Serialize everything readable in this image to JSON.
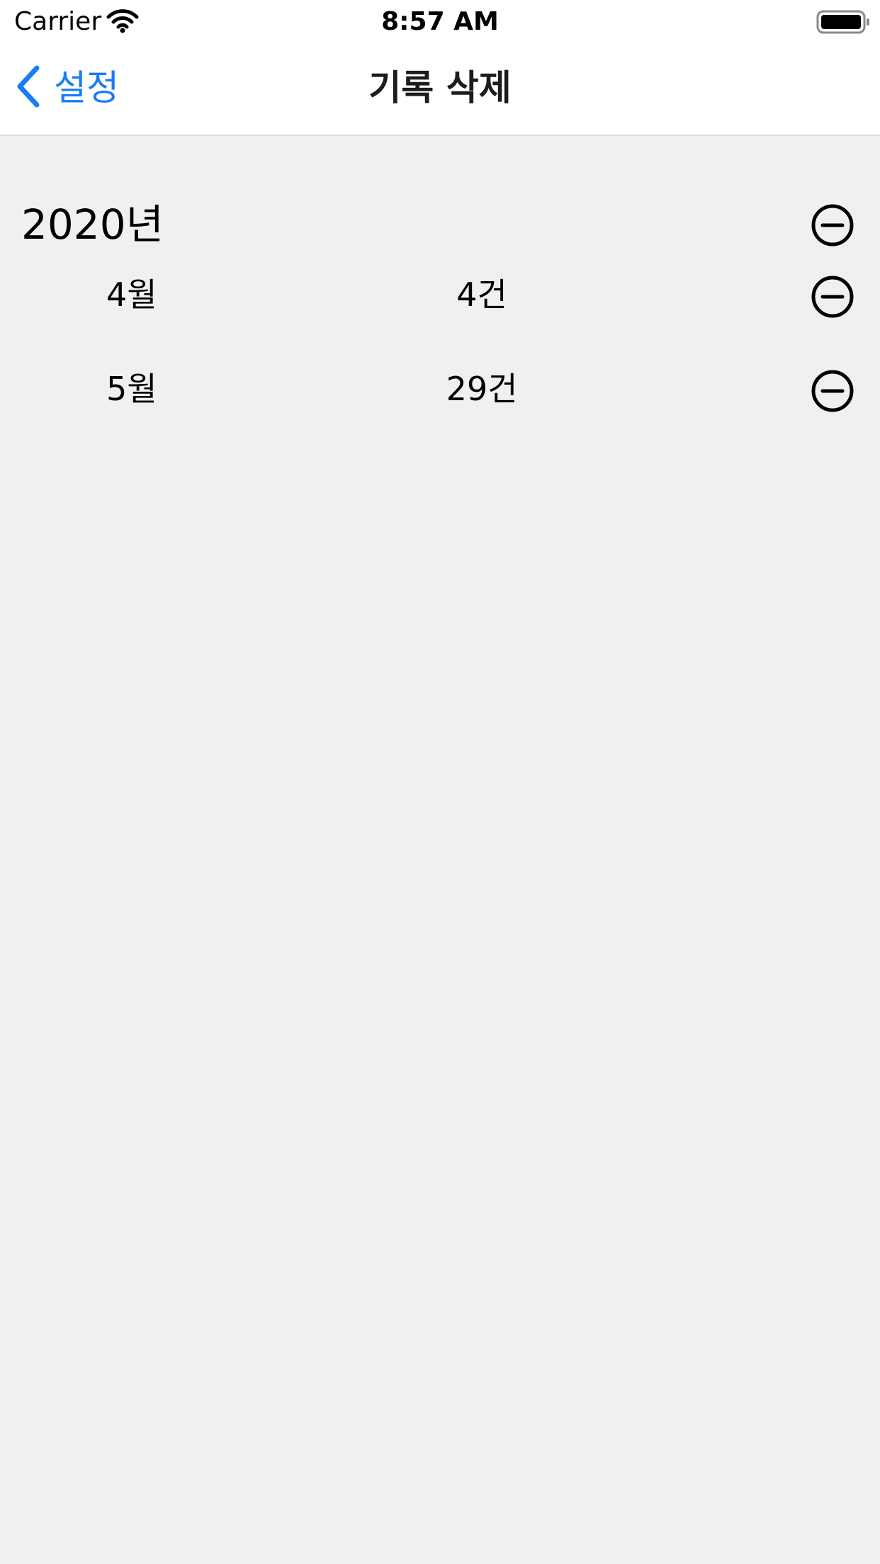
{
  "status_bar": {
    "carrier": "Carrier",
    "time": "8:57 AM"
  },
  "nav": {
    "back_label": "설정",
    "title": "기록 삭제"
  },
  "year_section": {
    "year_label": "2020년",
    "months": [
      {
        "month": "4월",
        "count": "4건"
      },
      {
        "month": "5월",
        "count": "29건"
      }
    ]
  },
  "icons": {
    "back": "chevron-left-icon",
    "delete": "minus-circle-icon",
    "wifi": "wifi-icon",
    "battery": "battery-icon"
  },
  "colors": {
    "accent": "#1a7cf5",
    "background": "#f0f0f0",
    "bar": "#ffffff"
  }
}
